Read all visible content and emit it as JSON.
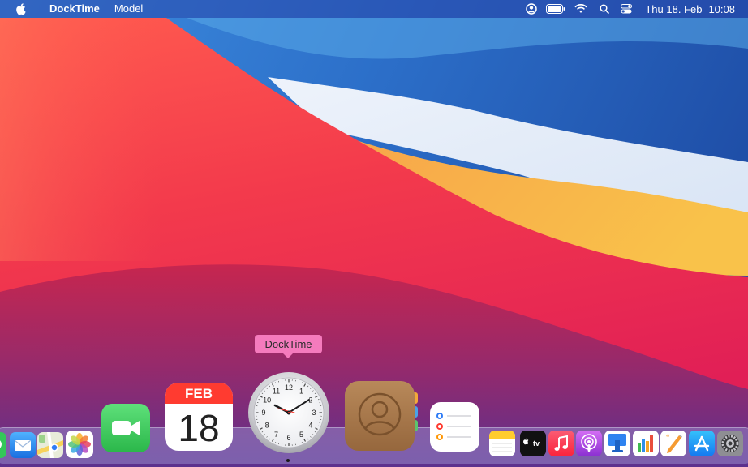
{
  "menubar": {
    "app_name": "DockTime",
    "menu": "Model",
    "date": "Thu 18. Feb",
    "time": "10:08"
  },
  "tooltip": {
    "label": "DockTime"
  },
  "calendar_icon": {
    "month": "FEB",
    "day": "18"
  },
  "clock_icon": {
    "numbers": [
      "12",
      "1",
      "2",
      "3",
      "4",
      "5",
      "6",
      "7",
      "8",
      "9",
      "10",
      "11"
    ]
  },
  "colors": {
    "menubar": "#2846aa",
    "tooltip": "#f57bbd",
    "dock": "#9687c8",
    "facetime": "#34c759",
    "calendar_header": "#ff3b30",
    "contacts": "#a67c52"
  },
  "dock": {
    "apps": [
      "messages-icon",
      "mail-icon",
      "maps-icon",
      "photos-icon",
      "facetime-icon",
      "calendar-icon",
      "docktime-clock-icon",
      "contacts-icon",
      "reminders-icon",
      "notes-icon",
      "apple-tv-icon",
      "music-icon",
      "podcasts-icon",
      "keynote-icon",
      "numbers-icon",
      "pages-icon",
      "app-store-icon",
      "system-preferences-icon"
    ]
  }
}
